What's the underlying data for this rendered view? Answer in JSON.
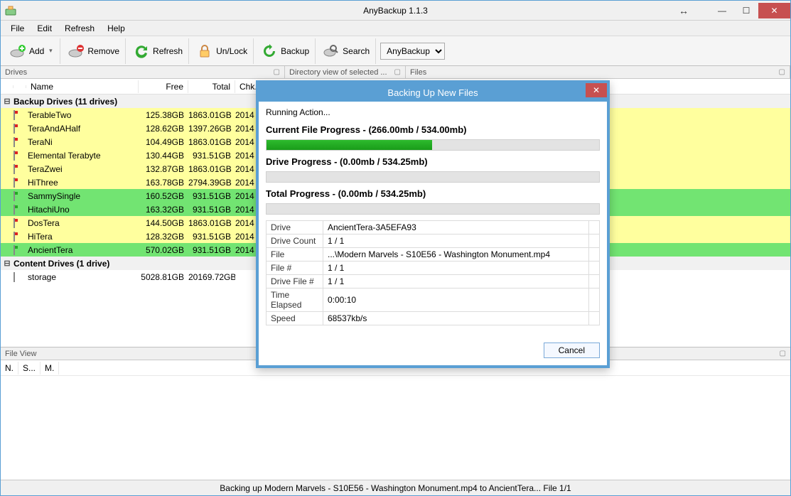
{
  "titlebar": {
    "title": "AnyBackup 1.1.3"
  },
  "menu": {
    "file": "File",
    "edit": "Edit",
    "refresh": "Refresh",
    "help": "Help"
  },
  "toolbar": {
    "add": "Add",
    "remove": "Remove",
    "refresh": "Refresh",
    "unlock": "Un/Lock",
    "backup": "Backup",
    "search": "Search",
    "selector": "AnyBackup"
  },
  "panels": {
    "drives": "Drives",
    "dirview": "Directory view of selected ...",
    "files": "Files"
  },
  "grid": {
    "cols": {
      "name": "Name",
      "free": "Free",
      "total": "Total",
      "chk": "Chk."
    },
    "group1": "Backup Drives (11 drives)",
    "group2": "Content Drives (1 drive)",
    "rows": [
      {
        "name": "TerableTwo",
        "free": "125.38GB",
        "total": "1863.01GB",
        "chk": "2014",
        "cls": "row-yellow",
        "icon": "red"
      },
      {
        "name": "TeraAndAHalf",
        "free": "128.62GB",
        "total": "1397.26GB",
        "chk": "2014",
        "cls": "row-yellow",
        "icon": "red"
      },
      {
        "name": "TeraNi",
        "free": "104.49GB",
        "total": "1863.01GB",
        "chk": "2014",
        "cls": "row-yellow",
        "icon": "red"
      },
      {
        "name": "Elemental Terabyte",
        "free": "130.44GB",
        "total": "931.51GB",
        "chk": "2014",
        "cls": "row-yellow",
        "icon": "red"
      },
      {
        "name": "TeraZwei",
        "free": "132.87GB",
        "total": "1863.01GB",
        "chk": "2014",
        "cls": "row-yellow",
        "icon": "red"
      },
      {
        "name": "HiThree",
        "free": "163.78GB",
        "total": "2794.39GB",
        "chk": "2014",
        "cls": "row-yellow",
        "icon": "red"
      },
      {
        "name": "SammySingle",
        "free": "160.52GB",
        "total": "931.51GB",
        "chk": "2014",
        "cls": "row-green",
        "icon": "green"
      },
      {
        "name": "HitachiUno",
        "free": "163.32GB",
        "total": "931.51GB",
        "chk": "2014",
        "cls": "row-green",
        "icon": "green"
      },
      {
        "name": "DosTera",
        "free": "144.50GB",
        "total": "1863.01GB",
        "chk": "2014",
        "cls": "row-yellow",
        "icon": "red"
      },
      {
        "name": "HiTera",
        "free": "128.32GB",
        "total": "931.51GB",
        "chk": "2014",
        "cls": "row-yellow",
        "icon": "red"
      },
      {
        "name": "AncientTera",
        "free": "570.02GB",
        "total": "931.51GB",
        "chk": "2014",
        "cls": "row-green",
        "icon": "green"
      }
    ],
    "content_rows": [
      {
        "name": "storage",
        "free": "5028.81GB",
        "total": "20169.72GB",
        "chk": "",
        "cls": "row-white",
        "icon": "stor"
      }
    ]
  },
  "fileview": {
    "title": "File View",
    "cols": {
      "n": "N.",
      "s": "S...",
      "m": "M."
    }
  },
  "status": "Backing up Modern Marvels - S10E56 - Washington Monument.mp4 to AncientTera... File 1/1",
  "dialog": {
    "title": "Backing Up New Files",
    "running": "Running Action...",
    "current_label": "Current File Progress - (266.00mb / 534.00mb)",
    "current_pct": 49.8,
    "drive_label": "Drive Progress - (0.00mb / 534.25mb)",
    "total_label": "Total Progress - (0.00mb / 534.25mb)",
    "rows": {
      "drive_k": "Drive",
      "drive_v": "AncientTera-3A5EFA93",
      "dcount_k": "Drive Count",
      "dcount_v": "1 / 1",
      "file_k": "File",
      "file_v": "...\\Modern Marvels - S10E56 - Washington Monument.mp4",
      "fnum_k": "File #",
      "fnum_v": "1 / 1",
      "dfnum_k": "Drive File #",
      "dfnum_v": "1 / 1",
      "time_k": "Time Elapsed",
      "time_v": "0:00:10",
      "speed_k": "Speed",
      "speed_v": "68537kb/s"
    },
    "cancel": "Cancel"
  }
}
